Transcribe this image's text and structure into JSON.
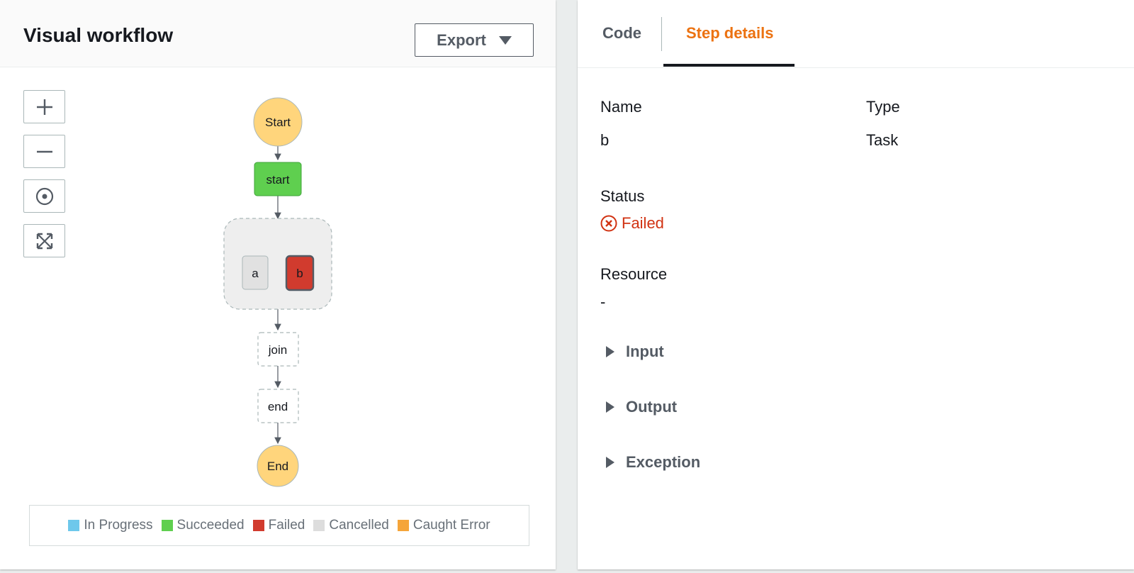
{
  "visual_workflow": {
    "title": "Visual workflow",
    "export_label": "Export",
    "controls": [
      {
        "name": "zoom-in",
        "icon": "plus-icon"
      },
      {
        "name": "zoom-out",
        "icon": "minus-icon"
      },
      {
        "name": "center",
        "icon": "target-icon"
      },
      {
        "name": "fit-to-screen",
        "icon": "expand-icon"
      }
    ],
    "graph": {
      "nodes": {
        "start_terminal": {
          "label": "Start",
          "color": "#ffd57c"
        },
        "start_task": {
          "label": "start",
          "status": "Succeeded",
          "color": "#5fcf4f"
        },
        "branch_a": {
          "label": "a",
          "status": "Cancelled",
          "color": "#e1e1e1"
        },
        "branch_b": {
          "label": "b",
          "status": "Failed",
          "color": "#d13b2e"
        },
        "join": {
          "label": "join"
        },
        "end_task": {
          "label": "end"
        },
        "end_terminal": {
          "label": "End",
          "color": "#ffd57c"
        }
      }
    },
    "legend": [
      {
        "label": "In Progress",
        "color": "#6ec8eb"
      },
      {
        "label": "Succeeded",
        "color": "#5fcf4f"
      },
      {
        "label": "Failed",
        "color": "#d13b2e"
      },
      {
        "label": "Cancelled",
        "color": "#dddddd"
      },
      {
        "label": "Caught Error",
        "color": "#f5a53a"
      }
    ]
  },
  "details_panel": {
    "tabs": {
      "code": "Code",
      "step_details": "Step details",
      "active": "step_details"
    },
    "fields": {
      "name_label": "Name",
      "name_value": "b",
      "type_label": "Type",
      "type_value": "Task",
      "status_label": "Status",
      "status_value": "Failed",
      "resource_label": "Resource",
      "resource_value": "-"
    },
    "sections": {
      "input": "Input",
      "output": "Output",
      "exception": "Exception"
    },
    "colors": {
      "accent": "#ec7211",
      "error": "#d13212"
    }
  }
}
